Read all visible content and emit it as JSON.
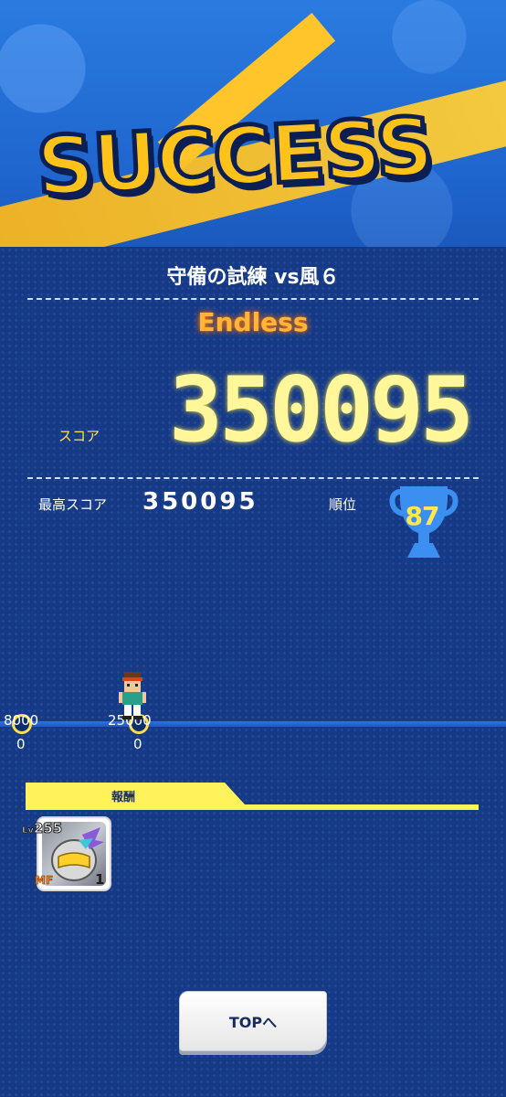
{
  "result": {
    "banner_text": "SUCCESS",
    "stage_title": "守備の試練 vs風６",
    "mode": "Endless",
    "score_label": "スコア",
    "score": "350095",
    "best_score_label": "最高スコア",
    "best_score": "350095",
    "rank_label": "順位",
    "rank": "87"
  },
  "progress": {
    "markers": [
      {
        "top_label": "8000",
        "bottom_label": "0"
      },
      {
        "top_label": "25000",
        "bottom_label": "0"
      }
    ]
  },
  "rewards": {
    "label": "報酬",
    "items": [
      {
        "level_prefix": "Lv",
        "level": "255",
        "position": "MF",
        "count": "1"
      }
    ]
  },
  "buttons": {
    "top_label": "TOPへ"
  },
  "colors": {
    "accent_yellow": "#ffc21a",
    "mode_orange": "#ffb638",
    "score_glow": "#fff79a",
    "panel_blue": "#163a86"
  }
}
